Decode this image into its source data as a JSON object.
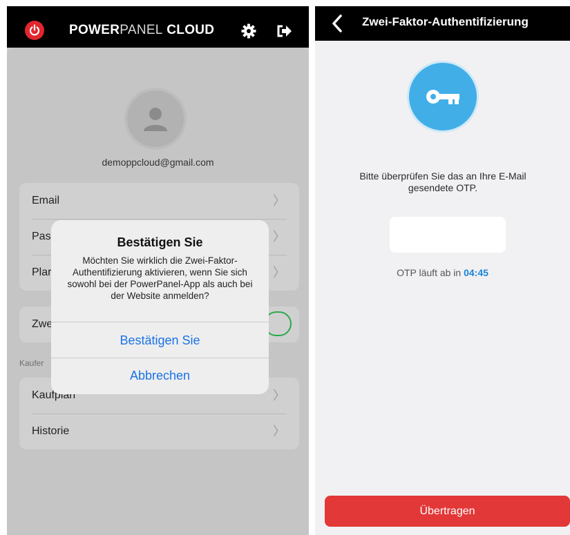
{
  "left_screen": {
    "brand": {
      "part1": "POWER",
      "part2": "PANEL",
      "part3": "CLOUD"
    },
    "email": "demoppcloud@gmail.com",
    "account_rows": [
      "Email",
      "Pas",
      "Plar"
    ],
    "two_factor_row": "Zwe",
    "purchase_section_label": "Kaufer",
    "purchase_rows": [
      "Kaufplan",
      "Historie"
    ],
    "toggle_on": true,
    "dialog": {
      "title": "Bestätigen Sie",
      "message": "Möchten Sie wirklich die Zwei-Faktor-Authentifizierung aktivieren, wenn Sie sich sowohl bei der PowerPanel-App als auch bei der Website anmelden?",
      "confirm": "Bestätigen Sie",
      "cancel": "Abbrechen"
    },
    "icons": [
      "power-icon",
      "gear-icon",
      "logout-icon",
      "user-icon",
      "chevron-right-icon"
    ],
    "colors": {
      "brand_red": "#e1262d",
      "toggle_green": "#29a84a",
      "link_blue": "#1a73e8"
    }
  },
  "right_screen": {
    "title": "Zwei-Faktor-Authentifizierung",
    "instruction": "Bitte überprüfen Sie das an Ihre E-Mail gesendete OTP.",
    "otp_value": "",
    "expiry_label": "OTP läuft ab in",
    "expiry_time": "04:45",
    "submit": "Übertragen",
    "icons": [
      "back-chevron-icon",
      "key-icon"
    ],
    "colors": {
      "key_circle": "#41aee8",
      "submit_red": "#e23838",
      "timer_blue": "#1a84d8"
    }
  }
}
